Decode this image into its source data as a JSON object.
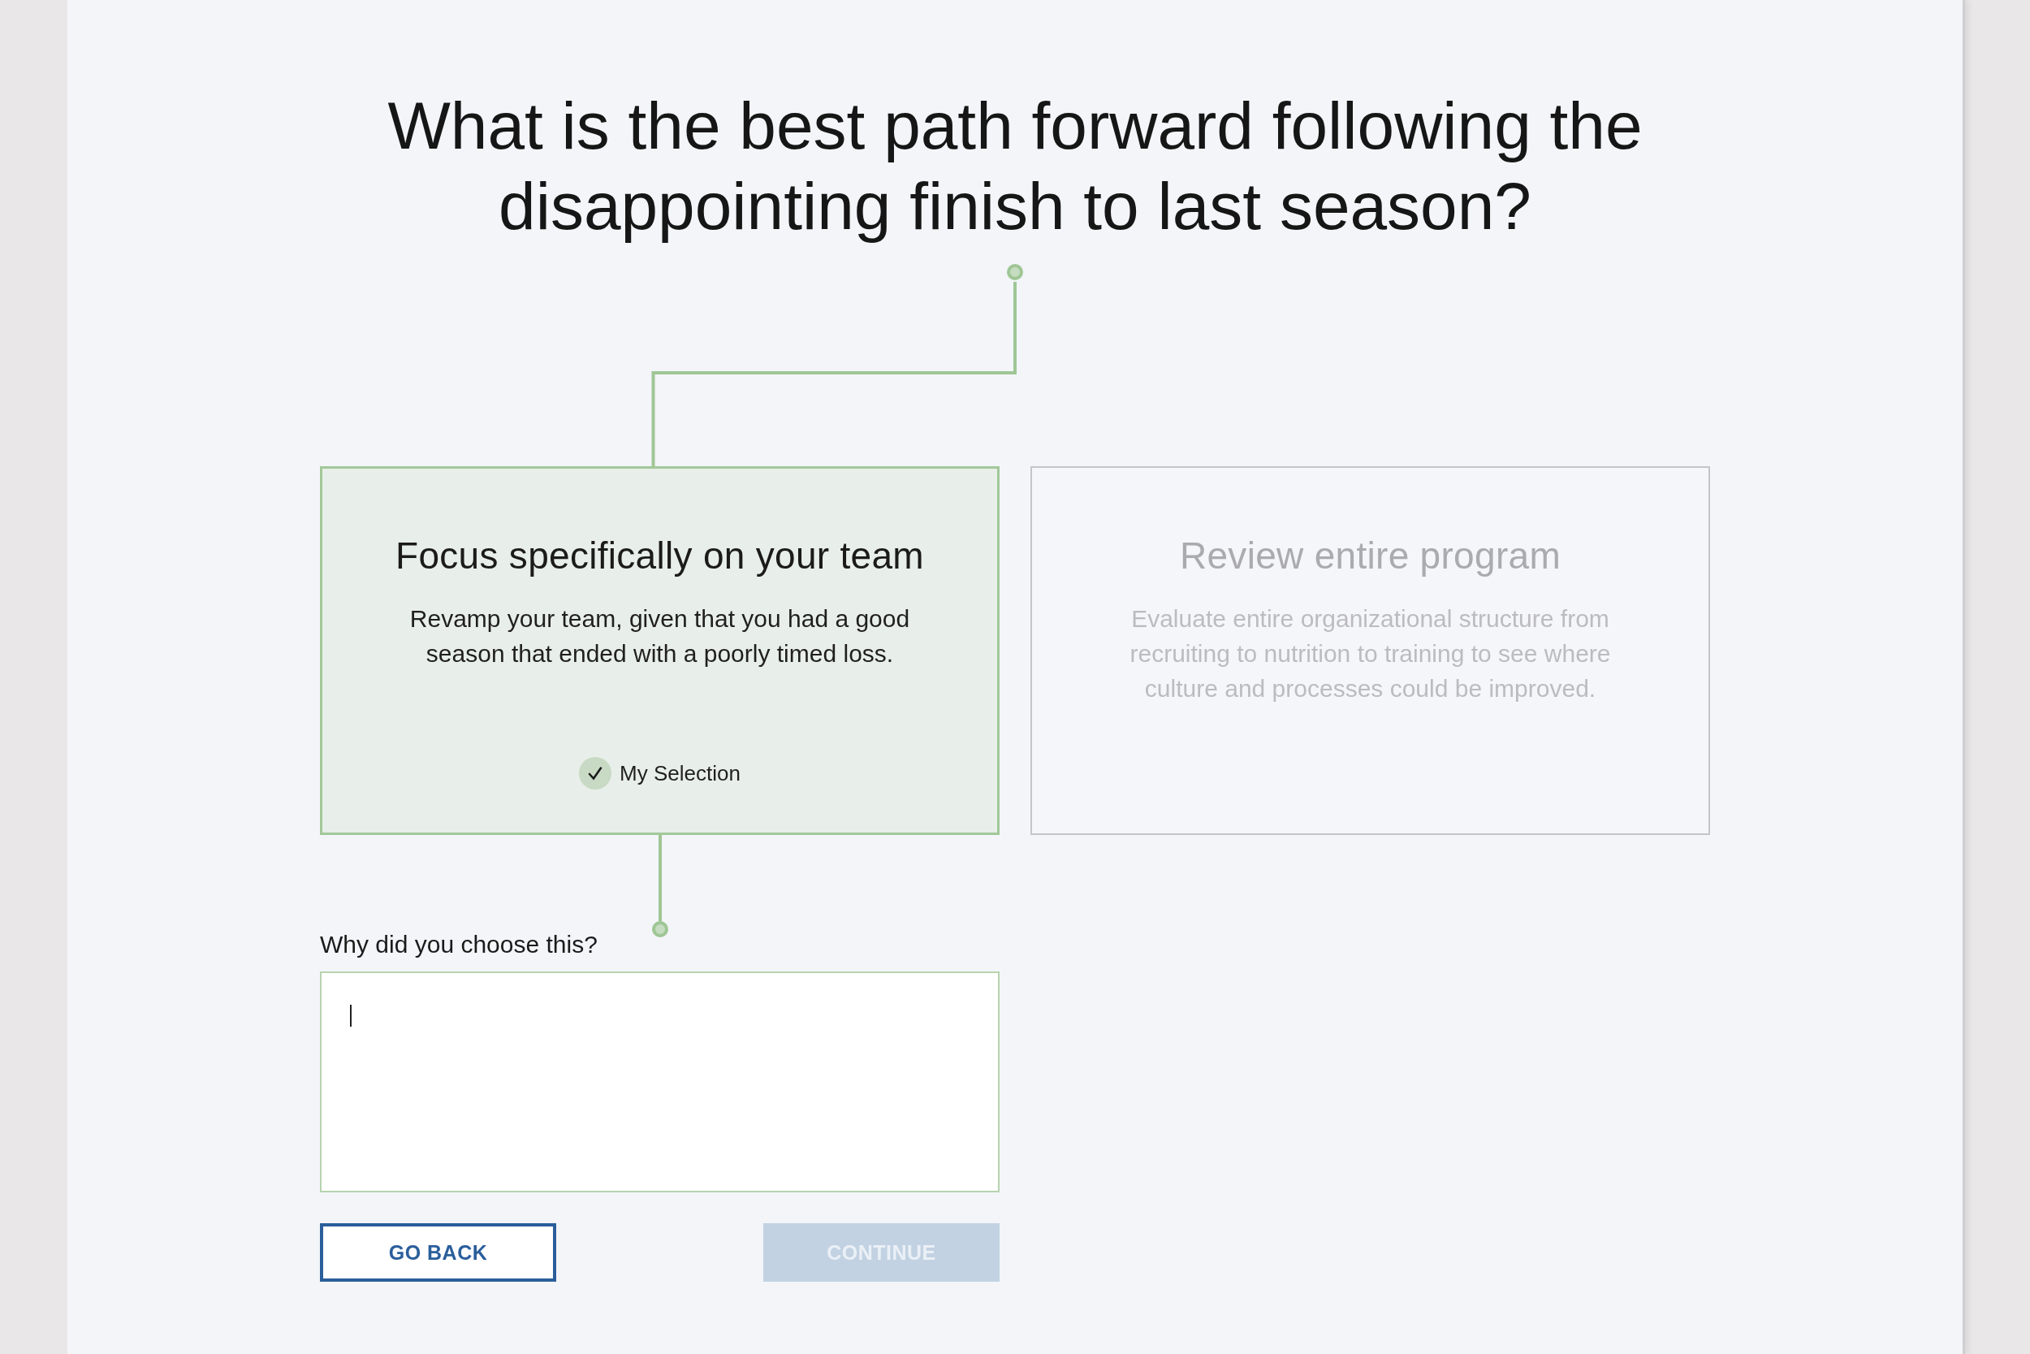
{
  "question": "What is the best path forward following the disappointing finish to last season?",
  "options": [
    {
      "title": "Focus specifically on your team",
      "description": "Revamp your team, given that you had a good season that ended with a poorly timed loss.",
      "selected": true
    },
    {
      "title": "Review entire program",
      "description": "Evaluate entire organizational structure from recruiting to nutrition to training to see where culture and processes could be improved.",
      "selected": false
    }
  ],
  "selection_label": "My Selection",
  "reason": {
    "label": "Why did you choose this?",
    "focused": true
  },
  "buttons": [
    {
      "label": "GO BACK",
      "kind": "secondary",
      "disabled": false
    },
    {
      "label": "CONTINUE",
      "kind": "primary",
      "disabled": true
    }
  ]
}
